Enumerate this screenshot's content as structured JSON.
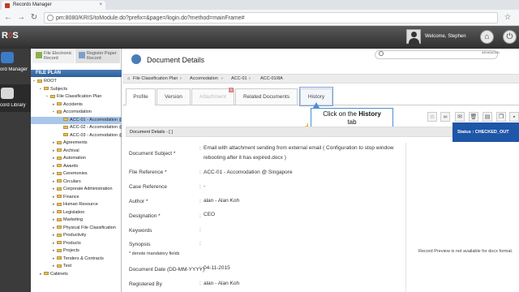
{
  "browser": {
    "tab_title": "Records Manager",
    "url": "pm:8080/KRIS/toModule.do?prefix=&page=/login.do?method=mainFrame#"
  },
  "header": {
    "logo_main": "R",
    "logo_accent": "S",
    "welcome": "Welcome, Stephen"
  },
  "rail": {
    "records_manager": "ord Manager",
    "record_library": "cord Library"
  },
  "left_panel": {
    "tab_file": "File Electronic Record",
    "tab_register": "Register Paper Record",
    "fileplan_label": "FILE PLAN",
    "tree": [
      {
        "label": "ROOT",
        "indent": 0,
        "toggle": "▪"
      },
      {
        "label": "Subjects",
        "indent": 1,
        "toggle": "▪"
      },
      {
        "label": "File Classification Plan",
        "indent": 2,
        "toggle": "▪"
      },
      {
        "label": "Accidents",
        "indent": 3,
        "toggle": "▸"
      },
      {
        "label": "Accomodation",
        "indent": 3,
        "toggle": "▪"
      },
      {
        "label": "ACC-01 - Accomodation @",
        "indent": 4,
        "toggle": "",
        "selected": true
      },
      {
        "label": "ACC-02 - Accomodation @",
        "indent": 4,
        "toggle": ""
      },
      {
        "label": "ACC-03 - Accomodation @",
        "indent": 4,
        "toggle": ""
      },
      {
        "label": "Agreements",
        "indent": 3,
        "toggle": "▸"
      },
      {
        "label": "Archival",
        "indent": 3,
        "toggle": "▸"
      },
      {
        "label": "Automation",
        "indent": 3,
        "toggle": "▸"
      },
      {
        "label": "Awards",
        "indent": 3,
        "toggle": "▸"
      },
      {
        "label": "Ceremonies",
        "indent": 3,
        "toggle": "▸"
      },
      {
        "label": "Circulars",
        "indent": 3,
        "toggle": "▸"
      },
      {
        "label": "Corporate Administration",
        "indent": 3,
        "toggle": "▸"
      },
      {
        "label": "Finance",
        "indent": 3,
        "toggle": "▸"
      },
      {
        "label": "Human Resource",
        "indent": 3,
        "toggle": "▸"
      },
      {
        "label": "Legislation",
        "indent": 3,
        "toggle": "▸"
      },
      {
        "label": "Marketing",
        "indent": 3,
        "toggle": "▸"
      },
      {
        "label": "Physical File Classification",
        "indent": 3,
        "toggle": "▸"
      },
      {
        "label": "Productivity",
        "indent": 3,
        "toggle": "▸"
      },
      {
        "label": "Products",
        "indent": 3,
        "toggle": "▸"
      },
      {
        "label": "Projects",
        "indent": 3,
        "toggle": "▸"
      },
      {
        "label": "Tenders & Contracts",
        "indent": 3,
        "toggle": "▸"
      },
      {
        "label": "Test",
        "indent": 3,
        "toggle": "▸"
      },
      {
        "label": "Cabinets",
        "indent": 1,
        "toggle": "▸"
      }
    ]
  },
  "main": {
    "title": "Document Details",
    "breadcrumb": [
      "File Classification Plan",
      "Accomodation",
      "ACC-01",
      "ACC-01/8A"
    ],
    "search_advanced": "ADVANCED",
    "tabs": [
      {
        "label": "Profile",
        "state": "active"
      },
      {
        "label": "Version",
        "state": "normal"
      },
      {
        "label": "Attachment",
        "state": "disabled"
      },
      {
        "label": "Related Documents",
        "state": "normal"
      },
      {
        "label": "History",
        "state": "highlight"
      }
    ],
    "callout": {
      "pre": "Click on the ",
      "bold": "History",
      "post": "tab"
    },
    "details_header": "Document Details - [ ]",
    "status": "Status : CHECKED_OUT",
    "fields": {
      "subject_label": "Document Subject *",
      "subject_value": "Email with attachment sending from external email ( Configuration to stop window rebooting after it has expired.docx )",
      "fileref_label": "File Reference *",
      "fileref_value": "ACC-01 - Accomodation @ Singapore",
      "caseref_label": "Case Reference",
      "caseref_value": "-",
      "author_label": "Author *",
      "author_value": "alan - Alan Koh",
      "designation_label": "Designation *",
      "designation_value": "CEO",
      "keywords_label": "Keywords",
      "synopsis_label": "Synopsis",
      "date_label": "Document Date (DD-MM-YYYY)",
      "date_value": "04-11-2015",
      "registered_label": "Registered By",
      "registered_value": "alan - Alan Koh"
    },
    "mandatory_note": "* denote mandatory fields",
    "preview_note": "Record Preview is not available for docx format."
  }
}
